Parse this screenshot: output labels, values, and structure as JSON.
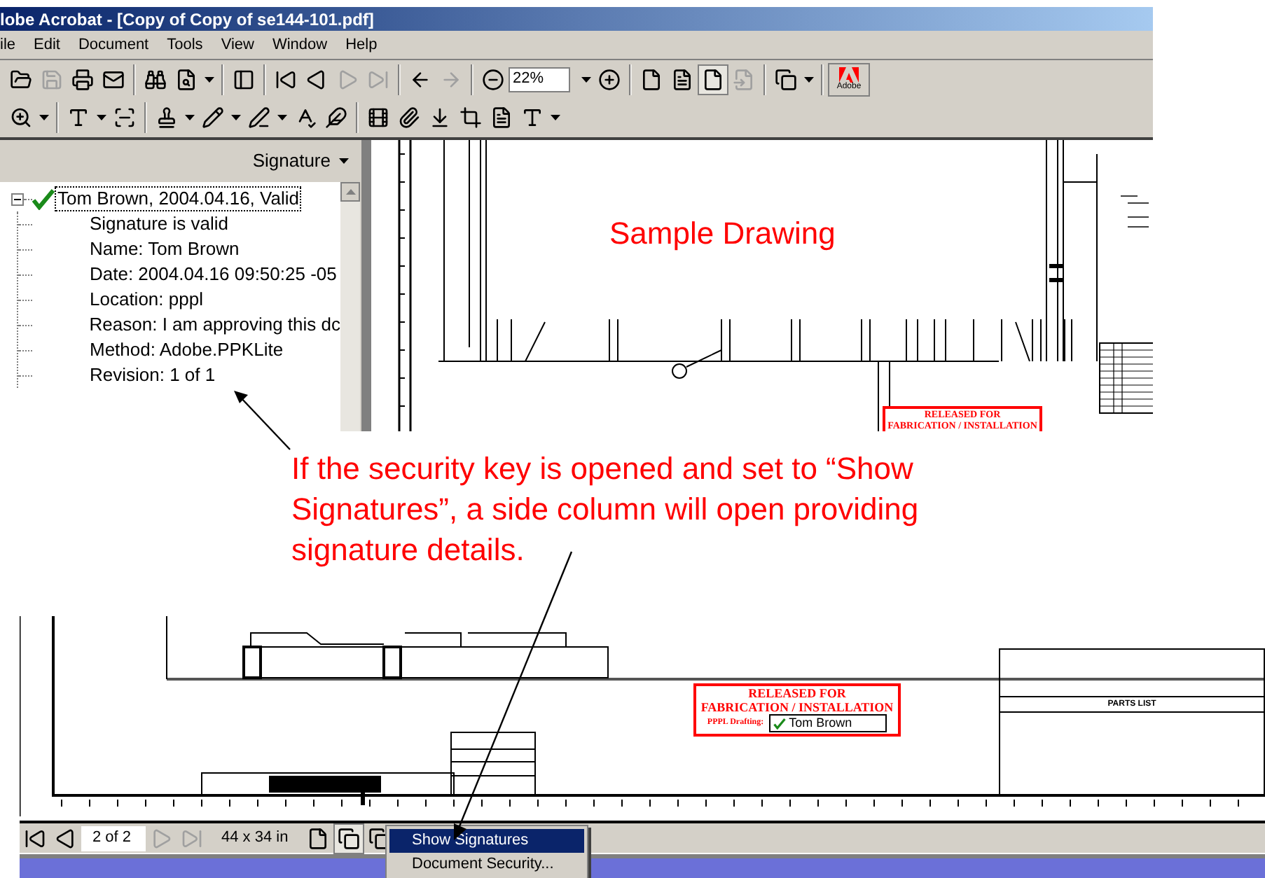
{
  "window": {
    "title": "lobe Acrobat - [Copy of Copy of se144-101.pdf]",
    "menu": [
      "ile",
      "Edit",
      "Document",
      "Tools",
      "View",
      "Window",
      "Help"
    ]
  },
  "toolbar": {
    "zoom_value": "22%",
    "logo_text": "Adobe"
  },
  "signature_panel": {
    "title": "Signature",
    "tree": {
      "label": "Tom Brown, 2004.04.16, Valid",
      "expanded": true,
      "children": [
        {
          "label": "Signature is valid"
        },
        {
          "label": "Name: Tom Brown"
        },
        {
          "label": "Date: 2004.04.16 09:50:25 -05"
        },
        {
          "label": "Location: pppl"
        },
        {
          "label": "Reason: I am approving this dc"
        },
        {
          "label": "Method: Adobe.PPKLite"
        },
        {
          "label": "Revision: 1 of 1"
        }
      ]
    }
  },
  "document": {
    "heading": "Sample Drawing",
    "stamp": {
      "line_1": "RELEASED FOR",
      "line_2": "FABRICATION / INSTALLATION"
    }
  },
  "callout": "If the security key is opened and set to “Show Signatures”, a side column will open providing signature details.",
  "bottom_view": {
    "stamp": {
      "line_1": "RELEASED FOR",
      "line_2": "FABRICATION / INSTALLATION",
      "drafting_label": "PPPL Drafting:",
      "signer": "Tom Brown"
    },
    "parts_list_title": "PARTS LIST",
    "status_bar": {
      "page": "2 of 2",
      "size": "44 x 34 in"
    },
    "context_menu": [
      {
        "label": "Show Signatures",
        "selected": true
      },
      {
        "label": "Document Security...",
        "selected": false
      }
    ]
  }
}
